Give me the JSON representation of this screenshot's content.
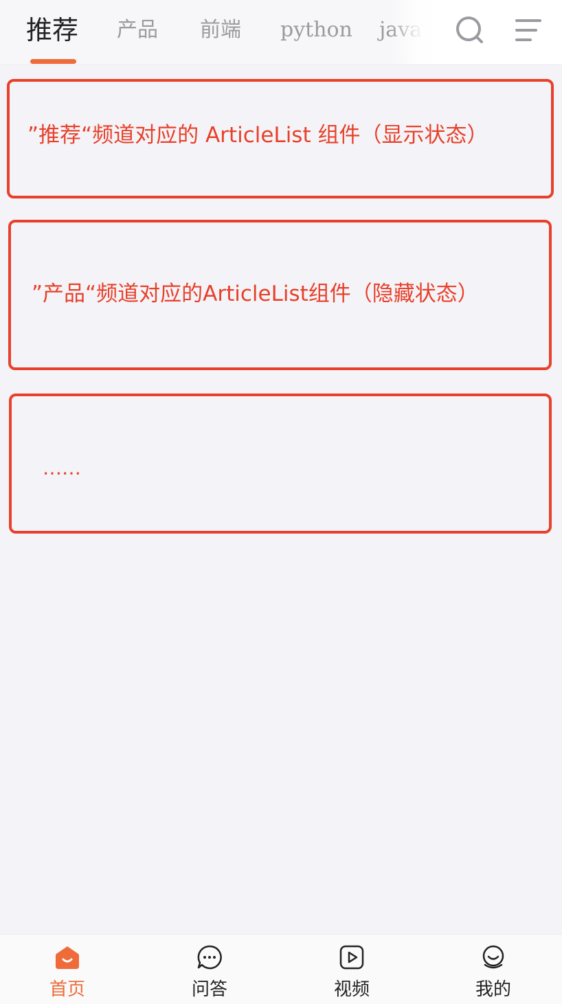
{
  "channels": {
    "tabs": [
      {
        "label": "推荐",
        "active": true
      },
      {
        "label": "产品",
        "active": false
      },
      {
        "label": "前端",
        "active": false
      },
      {
        "label": "python",
        "active": false
      },
      {
        "label": "java",
        "active": false
      }
    ],
    "search_icon": "search-icon",
    "menu_icon": "menu-icon"
  },
  "content": {
    "boxes": [
      {
        "text": "”推荐“频道对应的 ArticleList 组件（显示状态）"
      },
      {
        "text": "”产品“频道对应的ArticleList组件（隐藏状态）"
      },
      {
        "text": "……"
      }
    ]
  },
  "bottom_nav": {
    "items": [
      {
        "label": "首页",
        "icon": "home-icon",
        "active": true
      },
      {
        "label": "问答",
        "icon": "chat-bubble-icon",
        "active": false
      },
      {
        "label": "视频",
        "icon": "video-play-icon",
        "active": false
      },
      {
        "label": "我的",
        "icon": "user-face-icon",
        "active": false
      }
    ]
  },
  "colors": {
    "accent": "#ef6b3a",
    "annotation_red": "#e8402a",
    "background": "#f4f4f8"
  }
}
